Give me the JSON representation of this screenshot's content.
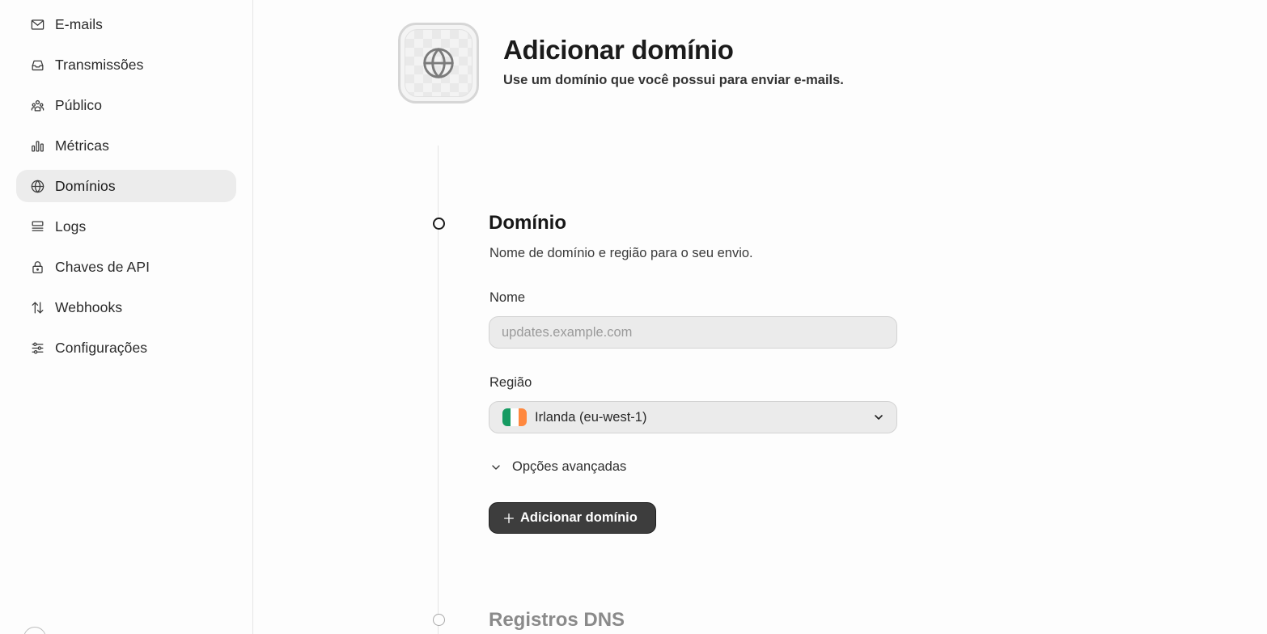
{
  "sidebar": {
    "items": [
      {
        "label": "E-mails",
        "icon": "mail-icon",
        "active": false
      },
      {
        "label": "Transmissões",
        "icon": "inbox-icon",
        "active": false
      },
      {
        "label": "Público",
        "icon": "users-icon",
        "active": false
      },
      {
        "label": "Métricas",
        "icon": "bar-chart-icon",
        "active": false
      },
      {
        "label": "Domínios",
        "icon": "globe-icon",
        "active": true
      },
      {
        "label": "Logs",
        "icon": "logs-icon",
        "active": false
      },
      {
        "label": "Chaves de API",
        "icon": "lock-icon",
        "active": false
      },
      {
        "label": "Webhooks",
        "icon": "arrows-up-down-icon",
        "active": false
      },
      {
        "label": "Configurações",
        "icon": "sliders-icon",
        "active": false
      }
    ]
  },
  "header": {
    "icon": "globe-icon",
    "title": "Adicionar domínio",
    "subtitle": "Use um domínio que você possui para enviar e-mails."
  },
  "domain_step": {
    "title": "Domínio",
    "description": "Nome de domínio e região para o seu envio.",
    "name_field": {
      "label": "Nome",
      "value": "",
      "placeholder": "updates.example.com"
    },
    "region_field": {
      "label": "Região",
      "value": "Irlanda (eu-west-1)",
      "flag_colors": [
        "#169B62",
        "#FFFFFF",
        "#FF883E"
      ]
    },
    "advanced_label": "Opções avançadas",
    "submit_label": "Adicionar domínio"
  },
  "dns_step": {
    "title": "Registros DNS"
  },
  "colors": {
    "active_nav_bg": "#ececec",
    "primary_button_bg": "#3d3d3d"
  }
}
